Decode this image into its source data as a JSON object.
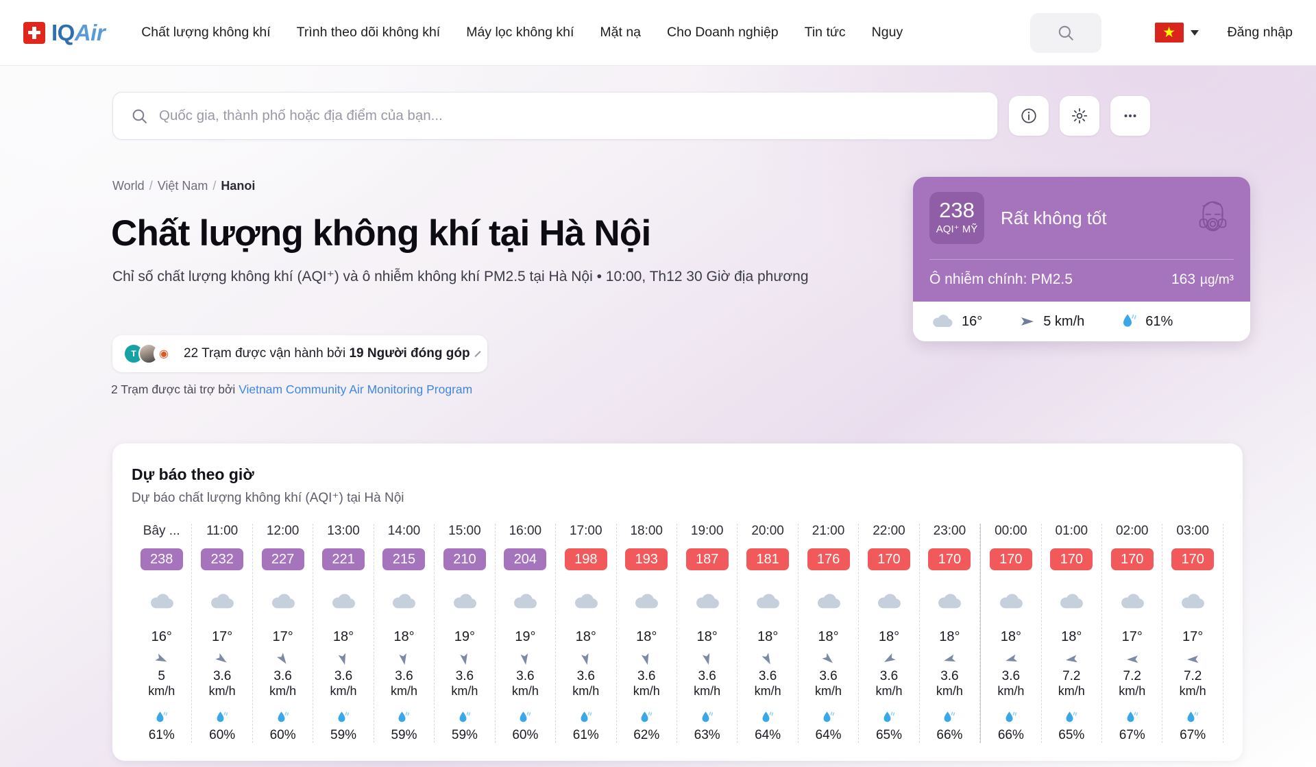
{
  "brand": {
    "iq": "IQ",
    "air": "Air",
    "flag_icon": "swiss-flag-icon"
  },
  "nav": {
    "links": [
      "Chất lượng không khí",
      "Trình theo dõi không khí",
      "Máy lọc không khí",
      "Mặt nạ",
      "Cho Doanh nghiệp",
      "Tin tức",
      "Nguy"
    ],
    "login_label": "Đăng nhập",
    "country_flag": "vietnam-flag-icon",
    "search_icon": "search-icon"
  },
  "search": {
    "placeholder": "Quốc gia, thành phố hoặc địa điểm của bạn...",
    "value": "",
    "icons": [
      "info-icon",
      "gear-icon",
      "ellipsis-icon"
    ]
  },
  "breadcrumb": {
    "world": "World",
    "country": "Việt Nam",
    "city": "Hanoi",
    "separator": "/"
  },
  "hero": {
    "title": "Chất lượng không khí tại Hà Nội",
    "subtitle": "Chỉ số chất lượng không khí (AQI⁺) và ô nhiễm không khí PM2.5 tại Hà Nội • 10:00, Th12 30 Giờ địa phương"
  },
  "stations": {
    "pill_prefix": "22 Trạm được vận hành bởi ",
    "pill_bold": "19 Người đóng góp",
    "sponsor_prefix": "2 Trạm được tài trợ bởi ",
    "sponsor_link": "Vietnam Community Air Monitoring Program"
  },
  "aqi_card": {
    "value": "238",
    "unit": "AQI⁺ MỸ",
    "level": "Rất không tốt",
    "level_color": "#a673bd",
    "icon": "gas-mask-face-icon",
    "pollutant_label": "Ô nhiễm chính: PM2.5",
    "pollutant_value": "163",
    "pollutant_unit": "µg/m³",
    "weather": {
      "temp": "16°",
      "wind": "5 km/h",
      "humidity": "61%",
      "temp_icon": "cloud-icon",
      "wind_icon": "wind-arrow-icon",
      "humidity_icon": "humidity-drop-icon"
    }
  },
  "forecast": {
    "title": "Dự báo theo giờ",
    "subtitle": "Dự báo chất lượng không khí (AQI⁺) tại Hà Nội",
    "colors": {
      "purple": "#a673bd",
      "red": "#f2595b"
    },
    "wind_unit": "km/h",
    "columns": [
      {
        "hour": "Bây ...",
        "aqi": "238",
        "color": "#a673bd",
        "temp": "16°",
        "wind": "5",
        "hum": "61%",
        "wind_dir": 25,
        "daybreak": false
      },
      {
        "hour": "11:00",
        "aqi": "232",
        "color": "#a673bd",
        "temp": "17°",
        "wind": "3.6",
        "hum": "60%",
        "wind_dir": 35,
        "daybreak": false
      },
      {
        "hour": "12:00",
        "aqi": "227",
        "color": "#a673bd",
        "temp": "17°",
        "wind": "3.6",
        "hum": "60%",
        "wind_dir": 55,
        "daybreak": false
      },
      {
        "hour": "13:00",
        "aqi": "221",
        "color": "#a673bd",
        "temp": "18°",
        "wind": "3.6",
        "hum": "59%",
        "wind_dir": 75,
        "daybreak": false
      },
      {
        "hour": "14:00",
        "aqi": "215",
        "color": "#a673bd",
        "temp": "18°",
        "wind": "3.6",
        "hum": "59%",
        "wind_dir": 80,
        "daybreak": false
      },
      {
        "hour": "15:00",
        "aqi": "210",
        "color": "#a673bd",
        "temp": "19°",
        "wind": "3.6",
        "hum": "59%",
        "wind_dir": 80,
        "daybreak": false
      },
      {
        "hour": "16:00",
        "aqi": "204",
        "color": "#a673bd",
        "temp": "19°",
        "wind": "3.6",
        "hum": "60%",
        "wind_dir": 82,
        "daybreak": false
      },
      {
        "hour": "17:00",
        "aqi": "198",
        "color": "#f2595b",
        "temp": "18°",
        "wind": "3.6",
        "hum": "61%",
        "wind_dir": 78,
        "daybreak": false
      },
      {
        "hour": "18:00",
        "aqi": "193",
        "color": "#f2595b",
        "temp": "18°",
        "wind": "3.6",
        "hum": "62%",
        "wind_dir": 76,
        "daybreak": false
      },
      {
        "hour": "19:00",
        "aqi": "187",
        "color": "#f2595b",
        "temp": "18°",
        "wind": "3.6",
        "hum": "63%",
        "wind_dir": 76,
        "daybreak": false
      },
      {
        "hour": "20:00",
        "aqi": "181",
        "color": "#f2595b",
        "temp": "18°",
        "wind": "3.6",
        "hum": "64%",
        "wind_dir": 62,
        "daybreak": false
      },
      {
        "hour": "21:00",
        "aqi": "176",
        "color": "#f2595b",
        "temp": "18°",
        "wind": "3.6",
        "hum": "64%",
        "wind_dir": 42,
        "daybreak": false
      },
      {
        "hour": "22:00",
        "aqi": "170",
        "color": "#f2595b",
        "temp": "18°",
        "wind": "3.6",
        "hum": "65%",
        "wind_dir": 150,
        "daybreak": false
      },
      {
        "hour": "23:00",
        "aqi": "170",
        "color": "#f2595b",
        "temp": "18°",
        "wind": "3.6",
        "hum": "66%",
        "wind_dir": 165,
        "daybreak": false
      },
      {
        "hour": "00:00",
        "aqi": "170",
        "color": "#f2595b",
        "temp": "18°",
        "wind": "3.6",
        "hum": "66%",
        "wind_dir": 165,
        "daybreak": true
      },
      {
        "hour": "01:00",
        "aqi": "170",
        "color": "#f2595b",
        "temp": "18°",
        "wind": "7.2",
        "hum": "65%",
        "wind_dir": 172,
        "daybreak": false
      },
      {
        "hour": "02:00",
        "aqi": "170",
        "color": "#f2595b",
        "temp": "17°",
        "wind": "7.2",
        "hum": "67%",
        "wind_dir": 178,
        "daybreak": false
      },
      {
        "hour": "03:00",
        "aqi": "170",
        "color": "#f2595b",
        "temp": "17°",
        "wind": "7.2",
        "hum": "67%",
        "wind_dir": 178,
        "daybreak": false
      }
    ]
  }
}
